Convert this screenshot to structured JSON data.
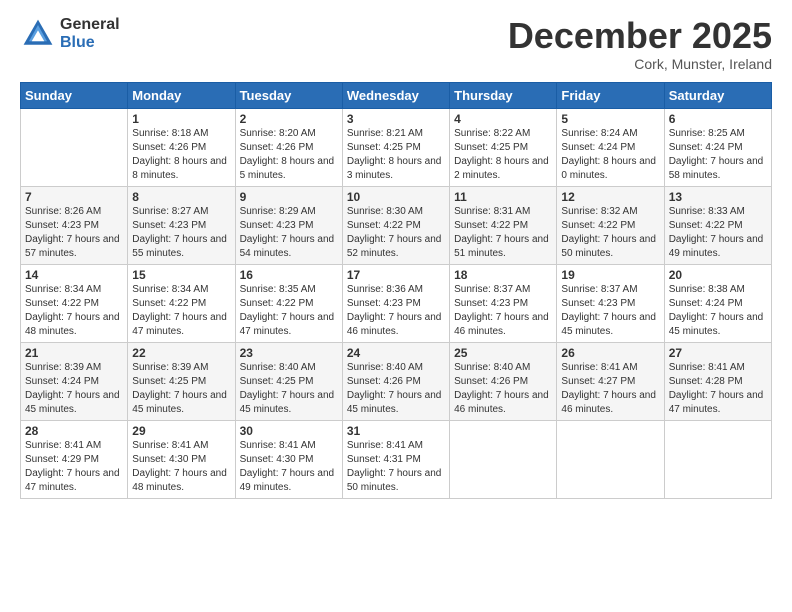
{
  "logo": {
    "general": "General",
    "blue": "Blue"
  },
  "title": "December 2025",
  "location": "Cork, Munster, Ireland",
  "days_header": [
    "Sunday",
    "Monday",
    "Tuesday",
    "Wednesday",
    "Thursday",
    "Friday",
    "Saturday"
  ],
  "weeks": [
    [
      {
        "day": "",
        "sunrise": "",
        "sunset": "",
        "daylight": ""
      },
      {
        "day": "1",
        "sunrise": "Sunrise: 8:18 AM",
        "sunset": "Sunset: 4:26 PM",
        "daylight": "Daylight: 8 hours and 8 minutes."
      },
      {
        "day": "2",
        "sunrise": "Sunrise: 8:20 AM",
        "sunset": "Sunset: 4:26 PM",
        "daylight": "Daylight: 8 hours and 5 minutes."
      },
      {
        "day": "3",
        "sunrise": "Sunrise: 8:21 AM",
        "sunset": "Sunset: 4:25 PM",
        "daylight": "Daylight: 8 hours and 3 minutes."
      },
      {
        "day": "4",
        "sunrise": "Sunrise: 8:22 AM",
        "sunset": "Sunset: 4:25 PM",
        "daylight": "Daylight: 8 hours and 2 minutes."
      },
      {
        "day": "5",
        "sunrise": "Sunrise: 8:24 AM",
        "sunset": "Sunset: 4:24 PM",
        "daylight": "Daylight: 8 hours and 0 minutes."
      },
      {
        "day": "6",
        "sunrise": "Sunrise: 8:25 AM",
        "sunset": "Sunset: 4:24 PM",
        "daylight": "Daylight: 7 hours and 58 minutes."
      }
    ],
    [
      {
        "day": "7",
        "sunrise": "Sunrise: 8:26 AM",
        "sunset": "Sunset: 4:23 PM",
        "daylight": "Daylight: 7 hours and 57 minutes."
      },
      {
        "day": "8",
        "sunrise": "Sunrise: 8:27 AM",
        "sunset": "Sunset: 4:23 PM",
        "daylight": "Daylight: 7 hours and 55 minutes."
      },
      {
        "day": "9",
        "sunrise": "Sunrise: 8:29 AM",
        "sunset": "Sunset: 4:23 PM",
        "daylight": "Daylight: 7 hours and 54 minutes."
      },
      {
        "day": "10",
        "sunrise": "Sunrise: 8:30 AM",
        "sunset": "Sunset: 4:22 PM",
        "daylight": "Daylight: 7 hours and 52 minutes."
      },
      {
        "day": "11",
        "sunrise": "Sunrise: 8:31 AM",
        "sunset": "Sunset: 4:22 PM",
        "daylight": "Daylight: 7 hours and 51 minutes."
      },
      {
        "day": "12",
        "sunrise": "Sunrise: 8:32 AM",
        "sunset": "Sunset: 4:22 PM",
        "daylight": "Daylight: 7 hours and 50 minutes."
      },
      {
        "day": "13",
        "sunrise": "Sunrise: 8:33 AM",
        "sunset": "Sunset: 4:22 PM",
        "daylight": "Daylight: 7 hours and 49 minutes."
      }
    ],
    [
      {
        "day": "14",
        "sunrise": "Sunrise: 8:34 AM",
        "sunset": "Sunset: 4:22 PM",
        "daylight": "Daylight: 7 hours and 48 minutes."
      },
      {
        "day": "15",
        "sunrise": "Sunrise: 8:34 AM",
        "sunset": "Sunset: 4:22 PM",
        "daylight": "Daylight: 7 hours and 47 minutes."
      },
      {
        "day": "16",
        "sunrise": "Sunrise: 8:35 AM",
        "sunset": "Sunset: 4:22 PM",
        "daylight": "Daylight: 7 hours and 47 minutes."
      },
      {
        "day": "17",
        "sunrise": "Sunrise: 8:36 AM",
        "sunset": "Sunset: 4:23 PM",
        "daylight": "Daylight: 7 hours and 46 minutes."
      },
      {
        "day": "18",
        "sunrise": "Sunrise: 8:37 AM",
        "sunset": "Sunset: 4:23 PM",
        "daylight": "Daylight: 7 hours and 46 minutes."
      },
      {
        "day": "19",
        "sunrise": "Sunrise: 8:37 AM",
        "sunset": "Sunset: 4:23 PM",
        "daylight": "Daylight: 7 hours and 45 minutes."
      },
      {
        "day": "20",
        "sunrise": "Sunrise: 8:38 AM",
        "sunset": "Sunset: 4:24 PM",
        "daylight": "Daylight: 7 hours and 45 minutes."
      }
    ],
    [
      {
        "day": "21",
        "sunrise": "Sunrise: 8:39 AM",
        "sunset": "Sunset: 4:24 PM",
        "daylight": "Daylight: 7 hours and 45 minutes."
      },
      {
        "day": "22",
        "sunrise": "Sunrise: 8:39 AM",
        "sunset": "Sunset: 4:25 PM",
        "daylight": "Daylight: 7 hours and 45 minutes."
      },
      {
        "day": "23",
        "sunrise": "Sunrise: 8:40 AM",
        "sunset": "Sunset: 4:25 PM",
        "daylight": "Daylight: 7 hours and 45 minutes."
      },
      {
        "day": "24",
        "sunrise": "Sunrise: 8:40 AM",
        "sunset": "Sunset: 4:26 PM",
        "daylight": "Daylight: 7 hours and 45 minutes."
      },
      {
        "day": "25",
        "sunrise": "Sunrise: 8:40 AM",
        "sunset": "Sunset: 4:26 PM",
        "daylight": "Daylight: 7 hours and 46 minutes."
      },
      {
        "day": "26",
        "sunrise": "Sunrise: 8:41 AM",
        "sunset": "Sunset: 4:27 PM",
        "daylight": "Daylight: 7 hours and 46 minutes."
      },
      {
        "day": "27",
        "sunrise": "Sunrise: 8:41 AM",
        "sunset": "Sunset: 4:28 PM",
        "daylight": "Daylight: 7 hours and 47 minutes."
      }
    ],
    [
      {
        "day": "28",
        "sunrise": "Sunrise: 8:41 AM",
        "sunset": "Sunset: 4:29 PM",
        "daylight": "Daylight: 7 hours and 47 minutes."
      },
      {
        "day": "29",
        "sunrise": "Sunrise: 8:41 AM",
        "sunset": "Sunset: 4:30 PM",
        "daylight": "Daylight: 7 hours and 48 minutes."
      },
      {
        "day": "30",
        "sunrise": "Sunrise: 8:41 AM",
        "sunset": "Sunset: 4:30 PM",
        "daylight": "Daylight: 7 hours and 49 minutes."
      },
      {
        "day": "31",
        "sunrise": "Sunrise: 8:41 AM",
        "sunset": "Sunset: 4:31 PM",
        "daylight": "Daylight: 7 hours and 50 minutes."
      },
      {
        "day": "",
        "sunrise": "",
        "sunset": "",
        "daylight": ""
      },
      {
        "day": "",
        "sunrise": "",
        "sunset": "",
        "daylight": ""
      },
      {
        "day": "",
        "sunrise": "",
        "sunset": "",
        "daylight": ""
      }
    ]
  ]
}
